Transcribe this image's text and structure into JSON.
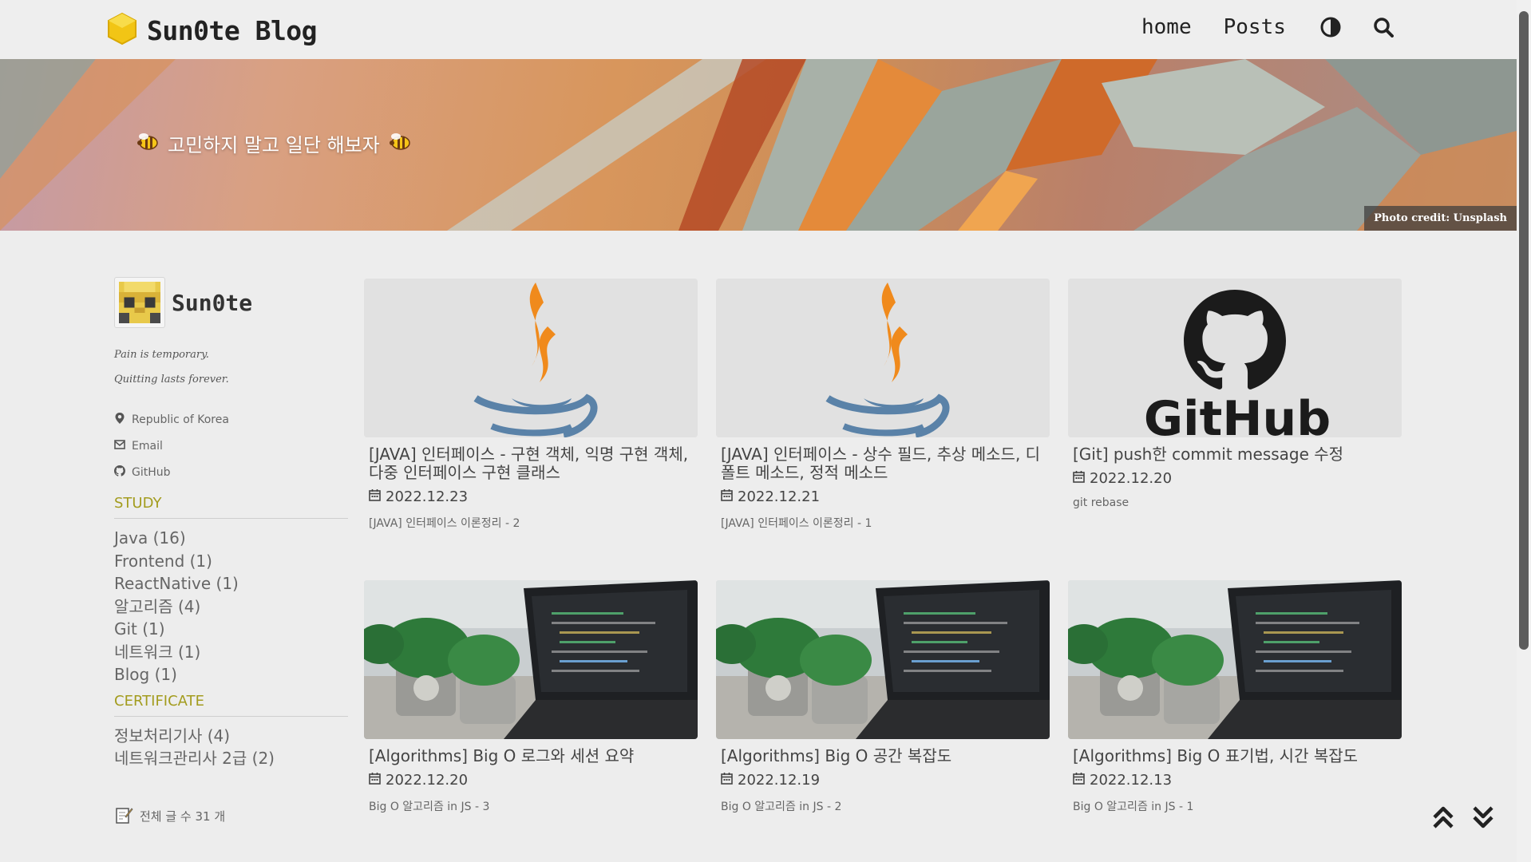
{
  "header": {
    "brand": "Sun0te Blog",
    "nav": {
      "home": "home",
      "posts": "Posts"
    },
    "icons": {
      "logo": "hexagon-logo-icon",
      "theme": "contrast-icon",
      "search": "search-icon"
    }
  },
  "hero": {
    "tagline": "고민하지 말고 일단 해보자",
    "credit_prefix": "Photo credit: ",
    "credit_source": "Unsplash",
    "emoji": "bee-icon"
  },
  "sidebar": {
    "name": "Sun0te",
    "bio_line1": "Pain is temporary.",
    "bio_line2": "Quitting lasts forever.",
    "location": "Republic of Korea",
    "email": "Email",
    "github": "GitHub",
    "study_title": "STUDY",
    "study": [
      "Java (16)",
      "Frontend (1)",
      "ReactNative (1)",
      "알고리즘 (4)",
      "Git (1)",
      "네트워크 (1)",
      "Blog (1)"
    ],
    "certificate_title": "CERTIFICATE",
    "certificate": [
      "정보처리기사 (4)",
      "네트워크관리사 2급 (2)"
    ],
    "total": "전체 글 수 31 개"
  },
  "posts": [
    {
      "title": "[JAVA] 인터페이스 - 구현 객체, 익명 구현 객체, 다중 인터페이스 구현 클래스",
      "date": "2022.12.23",
      "sub": "[JAVA] 인터페이스 이론정리 - 2",
      "thumb": "java"
    },
    {
      "title": "[JAVA] 인터페이스 - 상수 필드, 추상 메소드, 디폴트 메소드, 정적 메소드",
      "date": "2022.12.21",
      "sub": "[JAVA] 인터페이스 이론정리 - 1",
      "thumb": "java"
    },
    {
      "title": "[Git] push한 commit message 수정",
      "date": "2022.12.20",
      "sub": "git rebase",
      "thumb": "github",
      "thumb_text": "GitHub"
    },
    {
      "title": "[Algorithms] Big O 로그와 세션 요약",
      "date": "2022.12.20",
      "sub": "Big O 알고리즘 in JS - 3",
      "thumb": "laptop"
    },
    {
      "title": "[Algorithms] Big O 공간 복잡도",
      "date": "2022.12.19",
      "sub": "Big O 알고리즘 in JS - 2",
      "thumb": "laptop"
    },
    {
      "title": "[Algorithms] Big O 표기법, 시간 복잡도",
      "date": "2022.12.13",
      "sub": "Big O 알고리즘 in JS - 1",
      "thumb": "laptop"
    }
  ],
  "colors": {
    "category_title": "#a39c1e",
    "background": "#ededed"
  }
}
